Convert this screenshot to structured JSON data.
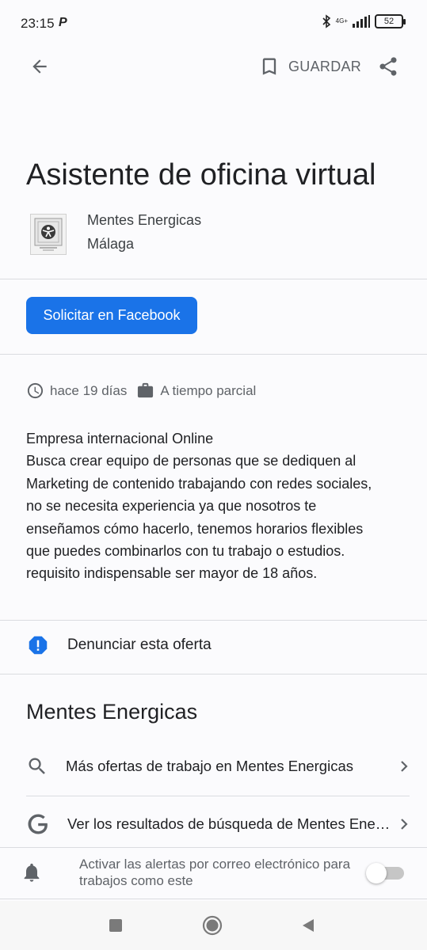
{
  "status_bar": {
    "time": "23:15",
    "pay_icon": "P",
    "network": "4G+",
    "battery": "52",
    "icons": [
      "bluetooth-icon",
      "signal-icon",
      "battery-icon"
    ]
  },
  "toolbar": {
    "save_label": "GUARDAR",
    "icons": [
      "back-arrow-icon",
      "bookmark-icon",
      "share-icon"
    ]
  },
  "job": {
    "title": "Asistente de oficina virtual",
    "company": "Mentes Energicas",
    "location": "Málaga",
    "apply_label": "Solicitar en Facebook",
    "posted": "hace 19 días",
    "type": "A tiempo parcial",
    "description_lines": [
      "Empresa internacional Online",
      "Busca crear equipo de personas que se dediquen al",
      "Marketing de contenido trabajando con redes sociales,",
      "no se necesita experiencia ya que nosotros te",
      "enseñamos cómo hacerlo, tenemos horarios flexibles",
      "que puedes combinarlos con tu trabajo o estudios.",
      "requisito indispensable ser mayor de 18 años."
    ]
  },
  "report": {
    "label": "Denunciar esta oferta"
  },
  "company_section": {
    "heading": "Mentes Energicas",
    "links": [
      {
        "label": "Más ofertas de trabajo en Mentes Energicas",
        "icon": "search-icon"
      },
      {
        "label": "Ver los resultados de búsqueda de Mentes Energicas",
        "icon": "google-icon"
      }
    ]
  },
  "alerts": {
    "label": "Activar las alertas por correo electrónico para trabajos como este",
    "enabled": false
  },
  "colors": {
    "accent": "#1a73e8",
    "text": "#202124",
    "secondary_text": "#5f6368",
    "divider": "#dadce0"
  }
}
